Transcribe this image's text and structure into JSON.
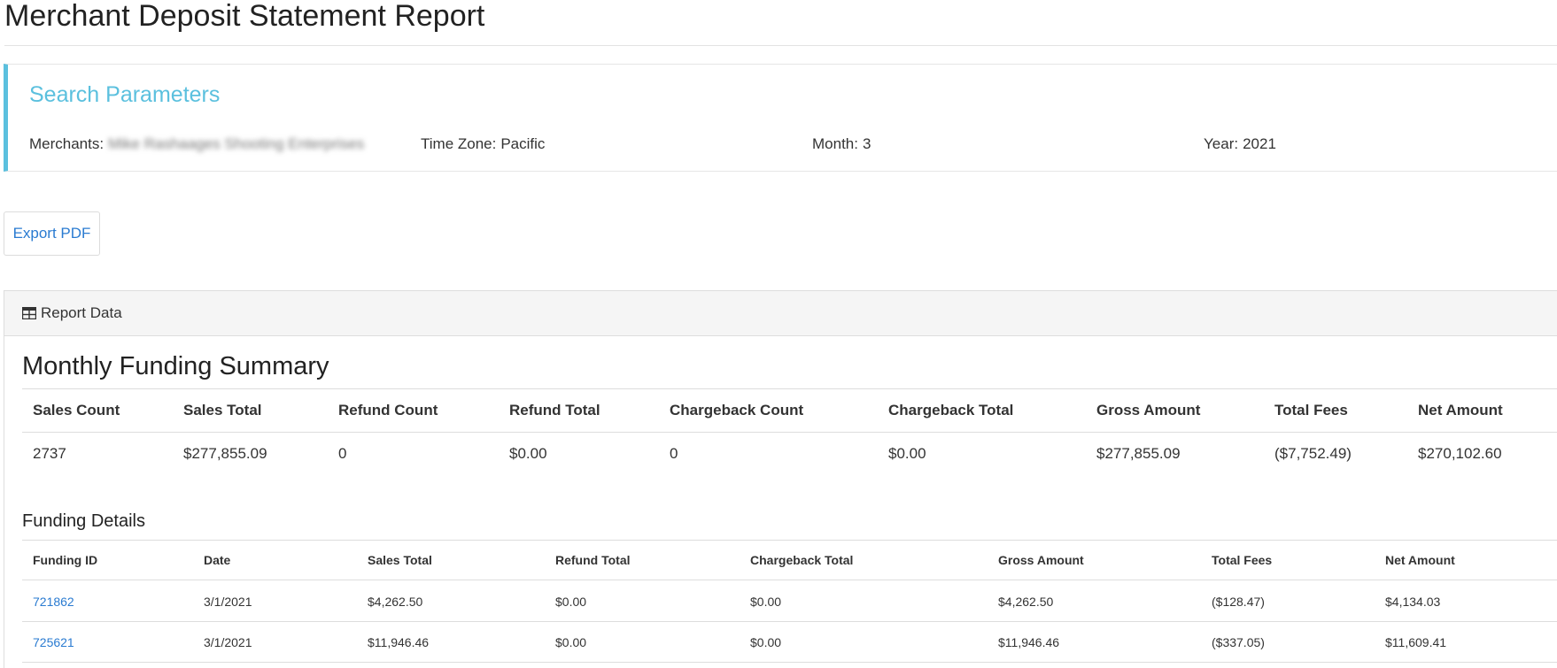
{
  "page": {
    "title": "Merchant Deposit Statement Report"
  },
  "search": {
    "heading": "Search Parameters",
    "merchants_label": "Merchants:",
    "merchants_value": "Mike Rashaages Shooting Enterprises",
    "timezone_label": "Time Zone:",
    "timezone_value": "Pacific",
    "month_label": "Month:",
    "month_value": "3",
    "year_label": "Year:",
    "year_value": "2021"
  },
  "toolbar": {
    "export_label": "Export PDF"
  },
  "report": {
    "panel_label": "Report Data",
    "panel_icon": "table-icon",
    "summary": {
      "title": "Monthly Funding Summary",
      "headers": [
        "Sales Count",
        "Sales Total",
        "Refund Count",
        "Refund Total",
        "Chargeback Count",
        "Chargeback Total",
        "Gross Amount",
        "Total Fees",
        "Net Amount"
      ],
      "values": [
        "2737",
        "$277,855.09",
        "0",
        "$0.00",
        "0",
        "$0.00",
        "$277,855.09",
        "($7,752.49)",
        "$270,102.60"
      ]
    },
    "details": {
      "title": "Funding Details",
      "headers": [
        "Funding ID",
        "Date",
        "Sales Total",
        "Refund Total",
        "Chargeback Total",
        "Gross Amount",
        "Total Fees",
        "Net Amount"
      ],
      "rows": [
        [
          "721862",
          "3/1/2021",
          "$4,262.50",
          "$0.00",
          "$0.00",
          "$4,262.50",
          "($128.47)",
          "$4,134.03"
        ],
        [
          "725621",
          "3/1/2021",
          "$11,946.46",
          "$0.00",
          "$0.00",
          "$11,946.46",
          "($337.05)",
          "$11,609.41"
        ]
      ]
    }
  },
  "colors": {
    "accent": "#5bc0de",
    "link": "#2a7bd1"
  }
}
